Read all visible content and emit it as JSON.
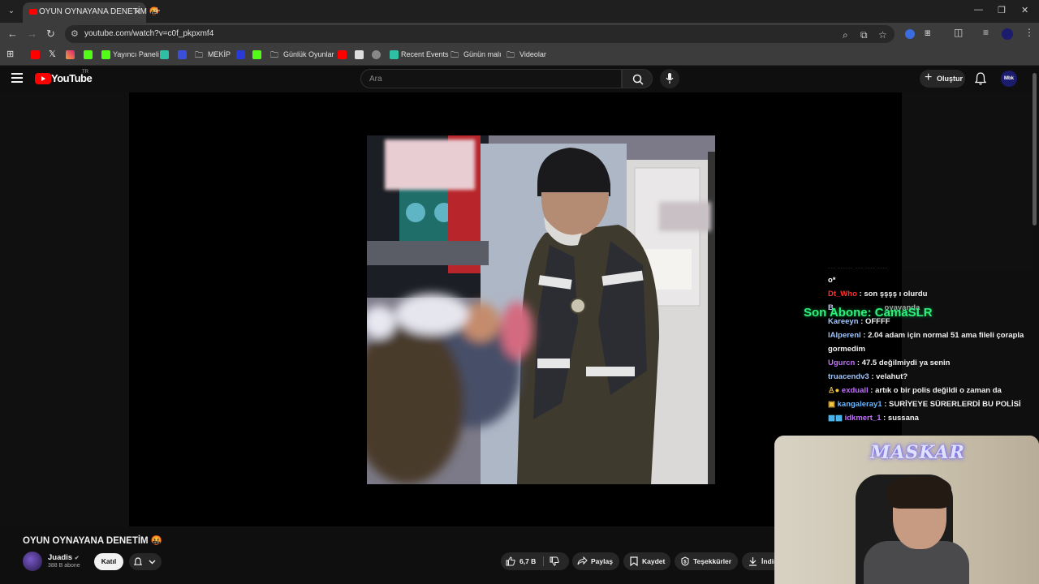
{
  "browser": {
    "tab_title": "OYUN OYNAYANA DENETİM 🤬",
    "url": "youtube.com/watch?v=c0f_pkpxmf4",
    "bookmarks": [
      "Yayıncı Paneli",
      "MEKİP",
      "Günlük Oyunlar",
      "Recent Events",
      "Günün malı",
      "Videolar"
    ]
  },
  "youtube": {
    "logo_text": "YouTube",
    "country": "TR",
    "search_placeholder": "Ara",
    "create_label": "Oluştur",
    "avatar_text": "Mbk"
  },
  "overlay": {
    "son_abone": "Son Abone: CamaSLR",
    "webcam_logo": "MASKAR"
  },
  "chat": [
    {
      "user": "o*",
      "msg": "",
      "color": "#ffffff"
    },
    {
      "user": "Dt_Who",
      "msg": ": son şşşş ı olurdu",
      "color": "#ff3030"
    },
    {
      "user": "B",
      "msg": "oyayanda",
      "color": "#c8c8ff"
    },
    {
      "user": "Kareeyn",
      "msg": ": OFFFF",
      "color": "#9fc6ff"
    },
    {
      "user": "lAlperenl",
      "msg": ": 2.04 adam için normal 51 ama fileli çorapla",
      "color": "#9fc6ff"
    },
    {
      "user": "",
      "msg": "gormedim",
      "color": "#ffffff"
    },
    {
      "user": "Ugurcn",
      "msg": ": 47.5 değilmiydi ya senin",
      "color": "#c070ff"
    },
    {
      "user": "truacendv3",
      "msg": ": velahut?",
      "color": "#9fc6ff"
    },
    {
      "user": "exduall",
      "msg": ": artık o bir polis değildi o zaman da",
      "color": "#c070ff"
    },
    {
      "user": "kangaleray1",
      "msg": ": SURİYEYE SÜRERLERDİ BU POLİSİ",
      "color": "#6ab7ff"
    },
    {
      "user": "idkmert_1",
      "msg": ": sussana",
      "color": "#c070ff"
    }
  ],
  "video": {
    "title": "OYUN OYNAYANA DENETİM 🤬",
    "channel": "Juadis",
    "subscribers": "388 B abone",
    "join_label": "Katıl",
    "likes": "6,7 B",
    "share_label": "Paylaş",
    "save_label": "Kaydet",
    "thanks_label": "Teşekkürler",
    "download_label": "İndir"
  }
}
